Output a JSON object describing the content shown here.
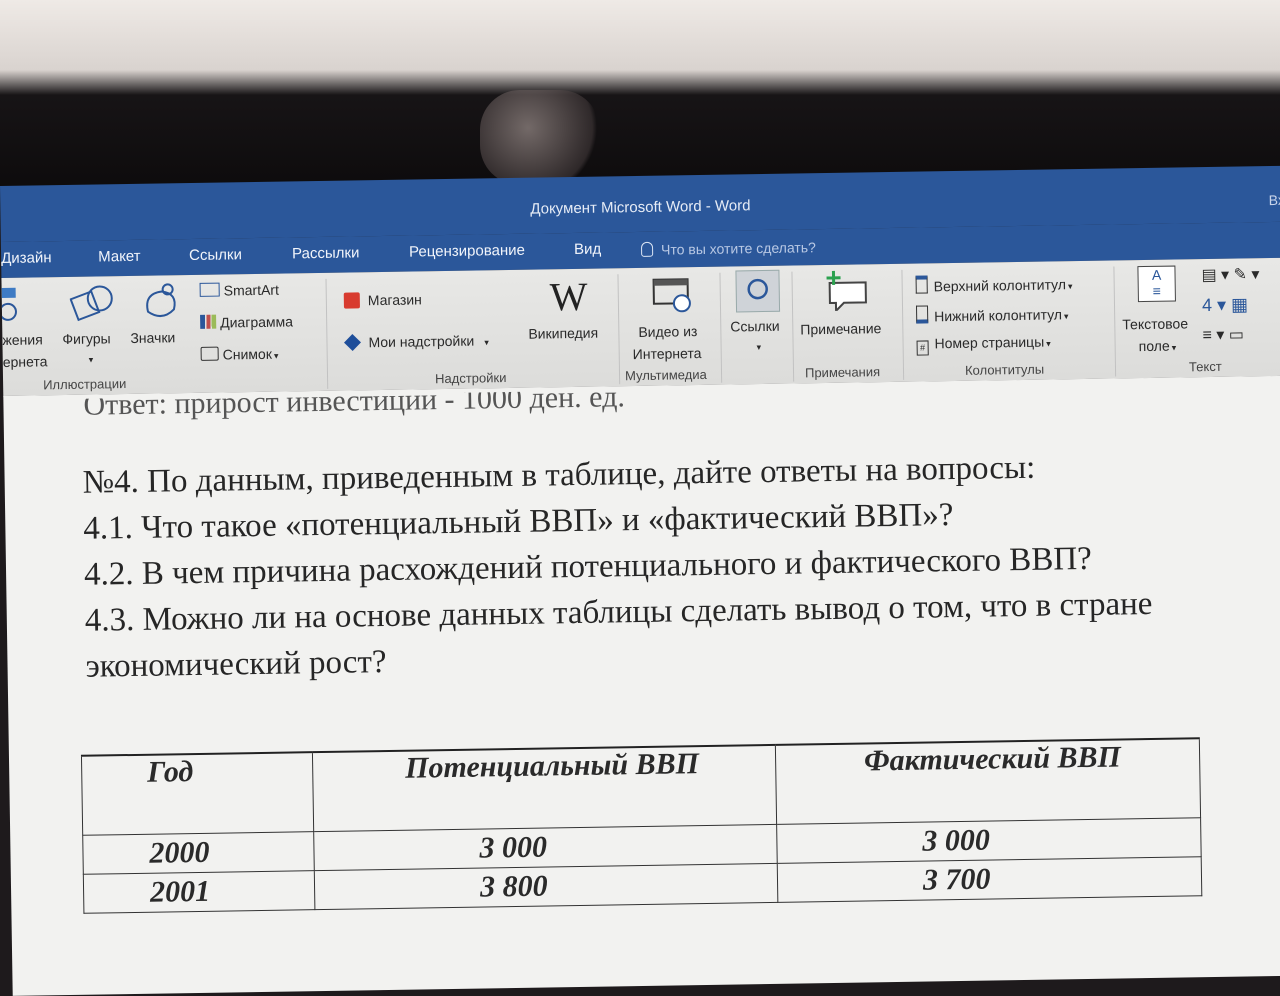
{
  "window": {
    "title": "Документ Microsoft Word  -  Word",
    "signin": "Вход"
  },
  "tabs": [
    "Дизайн",
    "Макет",
    "Ссылки",
    "Рассылки",
    "Рецензирование",
    "Вид"
  ],
  "tell_me": "Что вы хотите сделать?",
  "ribbon": {
    "illustrations": {
      "images_online_l1": "жения",
      "images_online_l2": "ернета",
      "shapes": "Фигуры",
      "icons": "Значки",
      "smartart": "SmartArt",
      "chart": "Диаграмма",
      "screenshot": "Снимок",
      "label": "Иллюстрации"
    },
    "addins": {
      "store": "Магазин",
      "my_addins": "Мои надстройки",
      "wikipedia": "Википедия",
      "label": "Надстройки"
    },
    "media": {
      "online_video_l1": "Видео из",
      "online_video_l2": "Интернета",
      "label": "Мультимедиа"
    },
    "links": {
      "links": "Ссылки"
    },
    "comments": {
      "comment": "Примечание",
      "label": "Примечания"
    },
    "header_footer": {
      "header": "Верхний колонтитул",
      "footer": "Нижний колонтитул",
      "page_number": "Номер страницы",
      "label": "Колонтитулы"
    },
    "text": {
      "textbox_l1": "Текстовое",
      "textbox_l2": "поле",
      "label": "Текст"
    }
  },
  "document": {
    "cut_line": "Ответ: прирост инвестиций - 1000 ден. ед.",
    "q_title": "№4. По данным, приведенным в таблице, дайте ответы на вопросы:",
    "q1": "4.1. Что такое «потенциальный ВВП» и «фактический ВВП»?",
    "q2": "4.2. В чем причина расхождений потенциального и фактического ВВП?",
    "q3": "4.3. Можно ли на основе данных таблицы сделать вывод о том, что в стране",
    "q3b": "экономический рост?",
    "table": {
      "headers": [
        "Год",
        "Потенциальный ВВП",
        "Фактический ВВП"
      ],
      "rows": [
        [
          "2000",
          "3 000",
          "3 000"
        ],
        [
          "2001",
          "3 800",
          "3 700"
        ]
      ]
    }
  }
}
